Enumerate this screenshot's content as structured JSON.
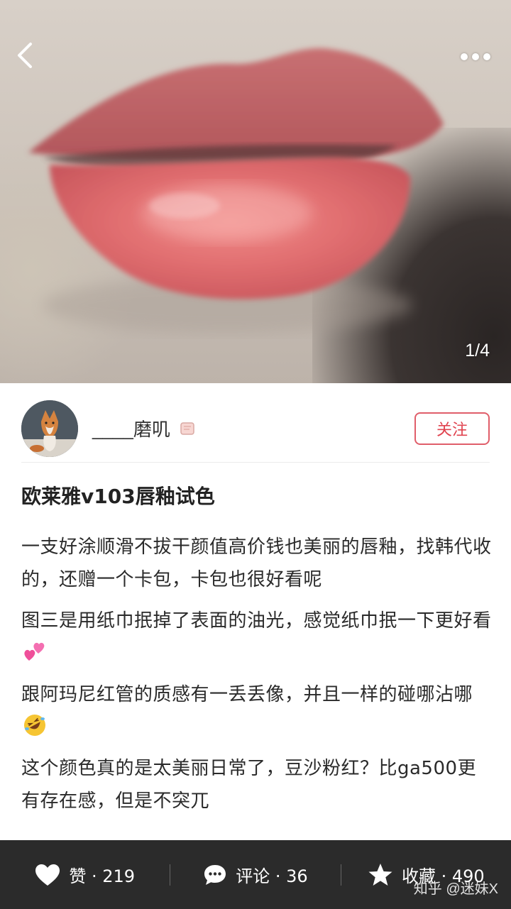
{
  "header": {
    "page_indicator": "1/4"
  },
  "author": {
    "name": "____磨叽",
    "follow_label": "关注"
  },
  "post": {
    "title": "欧莱雅v103唇釉试色",
    "paragraphs": [
      "一支好涂顺滑不拔干颜值高价钱也美丽的唇釉，找韩代收的，还赠一个卡包，卡包也很好看呢",
      "图三是用纸巾抿掉了表面的油光，感觉纸巾抿一下更好看",
      "跟阿玛尼红管的质感有一丢丢像，并且一样的碰哪沾哪",
      "这个颜色真的是太美丽日常了，豆沙粉红？比ga500更有存在感，但是不突兀"
    ]
  },
  "bottom_bar": {
    "like_label": "赞 · 219",
    "comment_label": "评论 · 36",
    "favorite_label": "收藏 · 490"
  },
  "watermark": "知乎 @迷妹X",
  "colors": {
    "accent": "#e0434f",
    "bar_bg": "#2b2b2b",
    "lip": "#d9666a"
  },
  "icons": [
    "back-arrow-icon",
    "more-dots-icon",
    "badge-icon",
    "two-hearts-emoji",
    "rofl-emoji",
    "heart-icon",
    "comment-bubble-icon",
    "star-icon"
  ]
}
